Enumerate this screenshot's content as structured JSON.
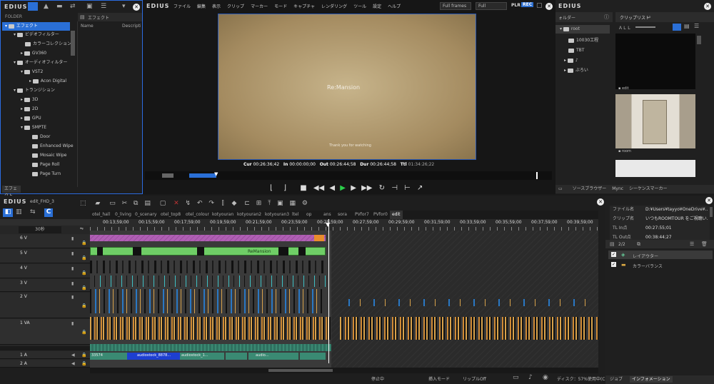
{
  "app": "EDIUS",
  "brand2": "EDIUS",
  "brand3": "EDIUS",
  "brand4": "EDIUS",
  "effect_panel": {
    "folder_label": "FOLDER",
    "tab": "エフェクト",
    "col_name": "Name",
    "col_desc": "Descripti",
    "footer_tab": "エフェクト",
    "tree": [
      "エフェクト",
      "ビデオフィルター",
      "カラーコレクション",
      "GV360",
      "オーディオフィルター",
      "VST2",
      "Acon Digital",
      "トランジション",
      "3D",
      "2D",
      "GPU",
      "SMPTE",
      "Door",
      "Enhanced Wipe",
      "Mosaic Wipe",
      "Page Roll",
      "Page Turn"
    ]
  },
  "menu": [
    "ファイル",
    "編集",
    "表示",
    "クリップ",
    "マーカー",
    "モード",
    "キャプチャ",
    "レンダリング",
    "ツール",
    "設定",
    "ヘルプ"
  ],
  "player": {
    "frames": "Full frames",
    "quality": "Full",
    "plr": "PLR",
    "rec": "REC",
    "logo": "Re:Mansion",
    "caption": "Thank you for watching",
    "cur_label": "Cur",
    "cur": "00:26:36;42",
    "in_label": "In",
    "in": "00:00:00;00",
    "out_label": "Out",
    "out": "00:26:44;58",
    "dur_label": "Dur",
    "dur": "00:26:44;58",
    "ttl_label": "Ttl",
    "ttl": "01:34:26;22"
  },
  "bin": {
    "folder_title": "ォルダー",
    "clip_title": "クリップリスト",
    "all": "ＡＬＬ",
    "root": "root",
    "folders": [
      "10030工程",
      "TBT",
      "♪",
      "ぶろい"
    ],
    "thumb1": "edit",
    "thumb2": "room",
    "tabs": [
      "ソースブラウザー",
      "Mync",
      "シーケンスマーカー"
    ]
  },
  "timeline": {
    "seq_name": "edit_FHD_3",
    "zoom": "30秒",
    "tabs": [
      "otel_hall",
      "0_living",
      "0_scenary",
      "otel_top8",
      "otel_colour",
      "kotyouran",
      "kotyouran2",
      "kotyouran3",
      "ltel",
      "op",
      "ans",
      "sora",
      "PVfor7",
      "PVfor0",
      "edit"
    ],
    "tcs": [
      "00:13;59;00",
      "00:15;59;00",
      "00:17;59;00",
      "00:19;59;00",
      "00:21;59;00",
      "00:23;59;00",
      "00:25;59;00",
      "00:27;59;00",
      "00:29;59;00",
      "00:31;59;00",
      "00:33;59;00",
      "00:35;59;00",
      "00:37;59;00",
      "00:39;59;00"
    ],
    "tracks": [
      "6 V",
      "5 V",
      "4 V",
      "3 V",
      "2 V",
      "1 VA",
      "1 A",
      "2 A"
    ],
    "clip_labels": [
      "ReMansion",
      "audiostock_8878...",
      "audiostock_1...",
      "audio...",
      "33574"
    ],
    "status": {
      "stop": "停止中",
      "insert": "挿入モード",
      "ripple": "リップルOff",
      "disk": "ディスク：57%使用中(C:)"
    }
  },
  "info": {
    "file_label": "ファイル名",
    "file_val": "D:¥Users¥tayyo¥OneDrive¥...",
    "clip_label": "クリップ名",
    "clip_val": "いつもROOMTOUR をご視聴い...",
    "tl_in_label": "TL In点",
    "tl_in": "00:27:55;01",
    "tl_out_label": "TL Out点",
    "tl_out": "00:38:44;27",
    "count": "2/2",
    "layers": [
      "レイアウター",
      "カラーバランス"
    ],
    "tabs": [
      "ジョブ",
      "インフォメーション"
    ]
  },
  "colors": {
    "accent": "#2a6fd6",
    "rec": "#2d6fd0",
    "purple": "#b05fb4",
    "green": "#6fce66",
    "cyan": "#3fc0c4",
    "orange": "#d8a24b"
  }
}
